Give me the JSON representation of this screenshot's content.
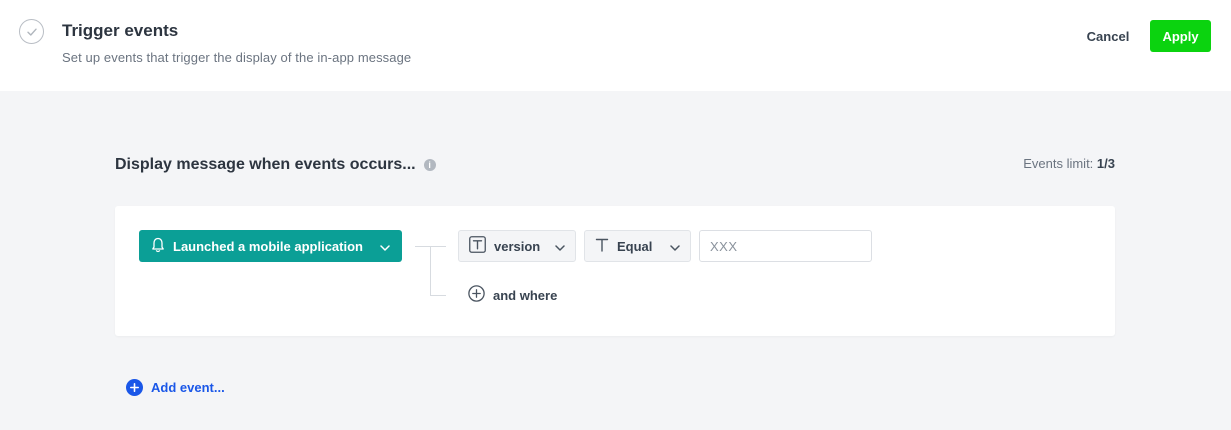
{
  "header": {
    "title": "Trigger events",
    "subtitle": "Set up events that trigger the display of the in-app message",
    "step_icon": "check-circle-icon",
    "cancel_label": "Cancel",
    "apply_label": "Apply",
    "apply_color": "#0bd30f"
  },
  "section": {
    "title": "Display message when events occurs...",
    "info_icon": "info-icon",
    "info_glyph": "i",
    "limit_label": "Events limit:",
    "limit_value": "1/3"
  },
  "event": {
    "name": "Launched a mobile application",
    "icon": "bell-icon",
    "color": "#0b9f96",
    "condition": {
      "attribute": "version",
      "attribute_icon": "text-type-icon",
      "operator": "Equal",
      "operator_icon": "text-type-icon",
      "value": "",
      "value_placeholder": "XXX"
    },
    "and_where_label": "and where"
  },
  "add_event": {
    "label": "Add event...",
    "color": "#1a57e8"
  }
}
